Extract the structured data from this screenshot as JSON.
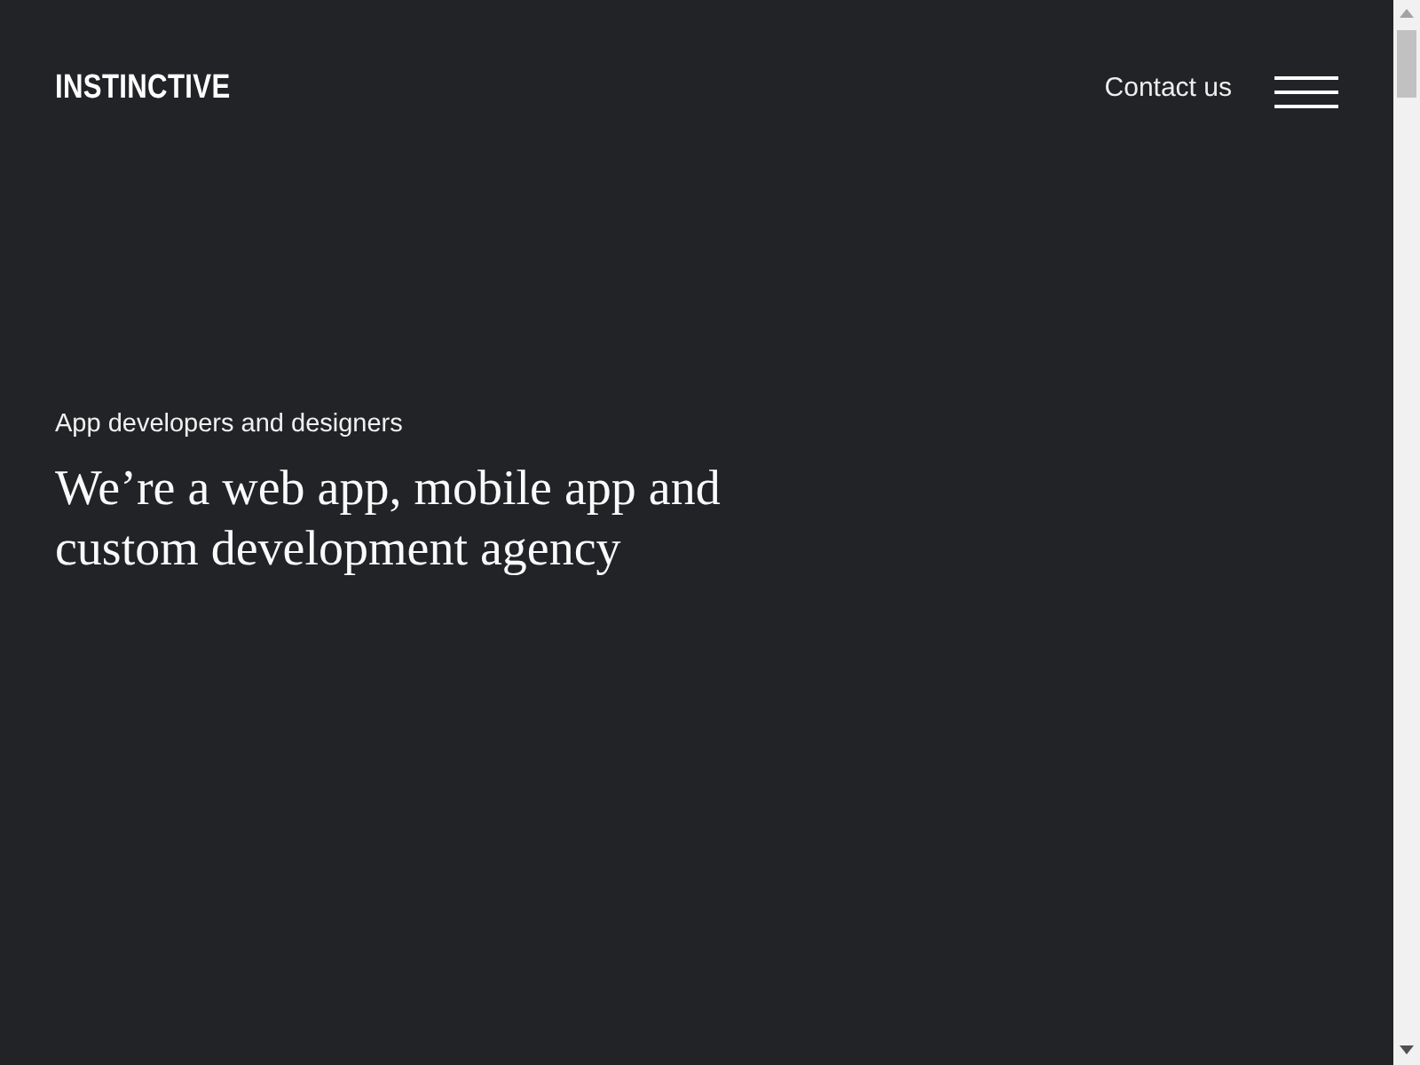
{
  "header": {
    "logo": "INSTINCTIVE",
    "contact_link": "Contact us"
  },
  "hero": {
    "eyebrow": "App developers and designers",
    "headline": "We’re a web app, mobile app and custom development agency"
  }
}
